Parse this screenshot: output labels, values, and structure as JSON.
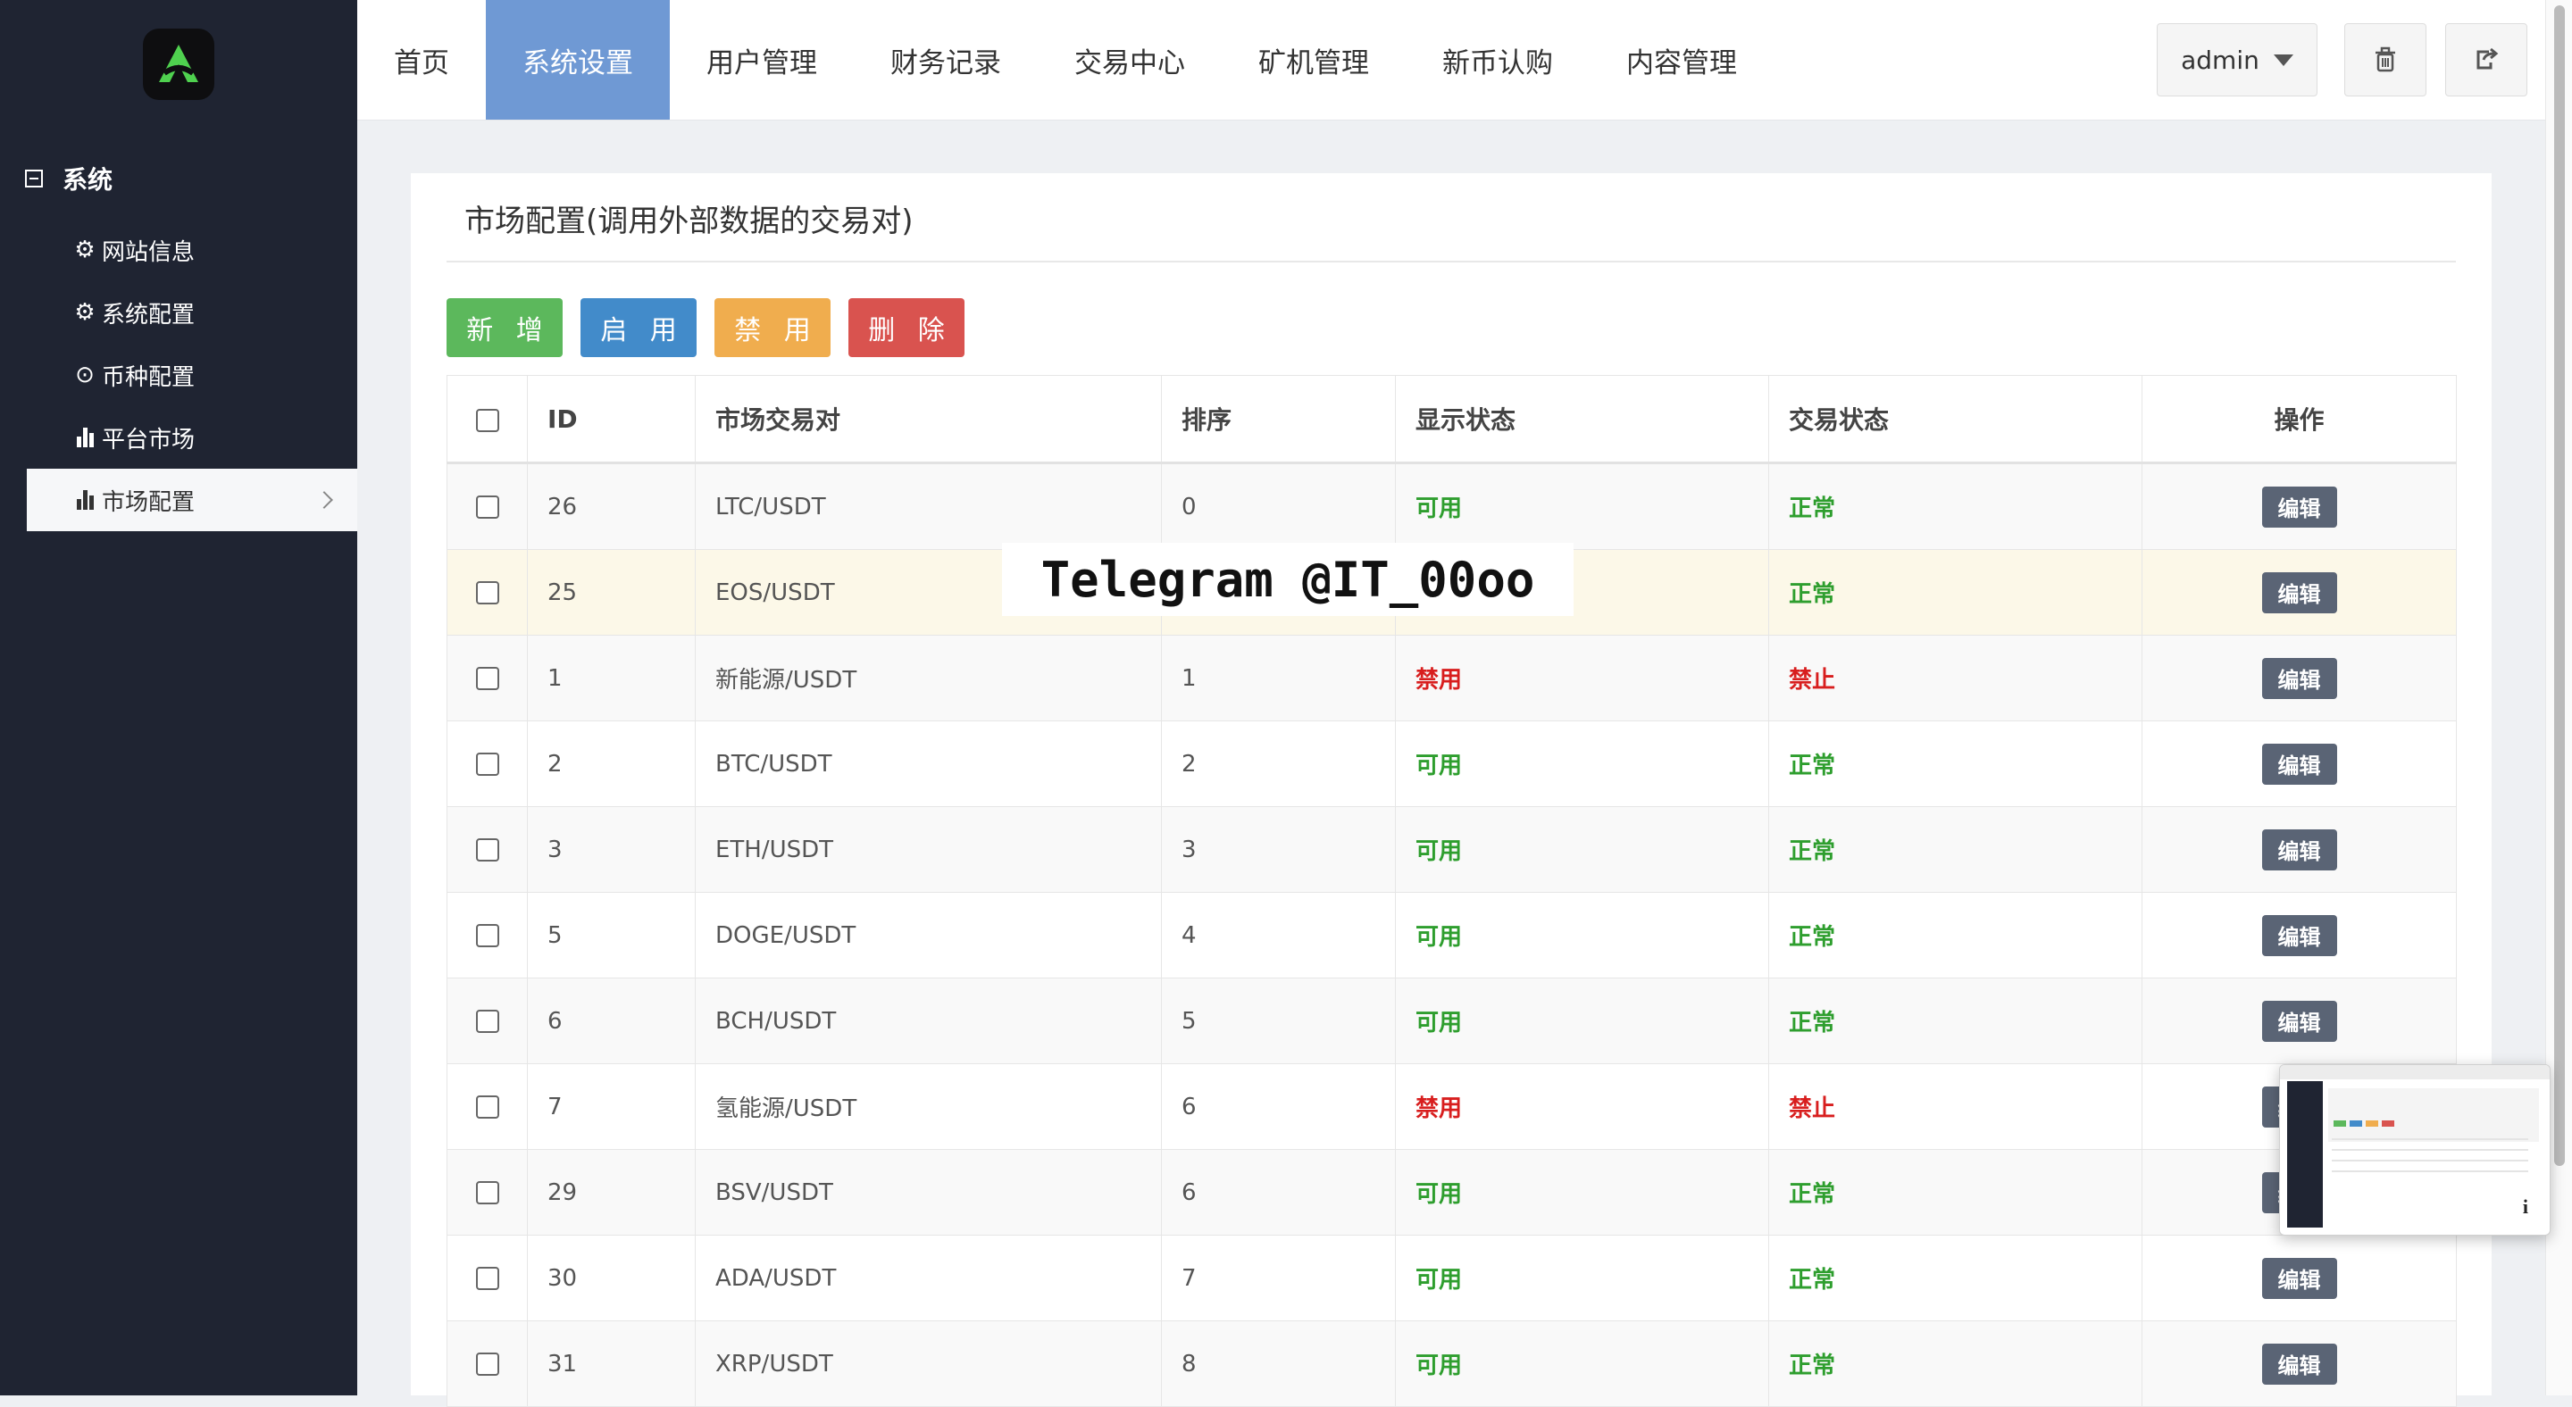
{
  "sidebar": {
    "section_title": "系统",
    "items": [
      {
        "label": "网站信息",
        "icon": "gear-icon"
      },
      {
        "label": "系统配置",
        "icon": "gear-icon"
      },
      {
        "label": "币种配置",
        "icon": "target-icon"
      },
      {
        "label": "平台市场",
        "icon": "bar-chart-icon"
      },
      {
        "label": "市场配置",
        "icon": "bar-chart-icon",
        "active": true
      }
    ]
  },
  "nav": {
    "tabs": [
      "首页",
      "系统设置",
      "用户管理",
      "财务记录",
      "交易中心",
      "矿机管理",
      "新币认购",
      "内容管理"
    ],
    "active_tab": "系统设置"
  },
  "user_menu": {
    "label": "admin"
  },
  "panel": {
    "title": "市场配置(调用外部数据的交易对)",
    "buttons": {
      "add": "新 增",
      "enable": "启 用",
      "disable": "禁 用",
      "delete": "删 除"
    }
  },
  "table": {
    "headers": {
      "id": "ID",
      "pair": "市场交易对",
      "sort": "排序",
      "display": "显示状态",
      "trade": "交易状态",
      "ops": "操作"
    },
    "edit_label": "编辑",
    "rows": [
      {
        "id": "26",
        "pair": "LTC/USDT",
        "sort": "0",
        "display": "可用",
        "trade": "正常"
      },
      {
        "id": "25",
        "pair": "EOS/USDT",
        "sort": "",
        "display": "",
        "trade": "正常"
      },
      {
        "id": "1",
        "pair": "新能源/USDT",
        "sort": "1",
        "display": "禁用",
        "trade": "禁止"
      },
      {
        "id": "2",
        "pair": "BTC/USDT",
        "sort": "2",
        "display": "可用",
        "trade": "正常"
      },
      {
        "id": "3",
        "pair": "ETH/USDT",
        "sort": "3",
        "display": "可用",
        "trade": "正常"
      },
      {
        "id": "5",
        "pair": "DOGE/USDT",
        "sort": "4",
        "display": "可用",
        "trade": "正常"
      },
      {
        "id": "6",
        "pair": "BCH/USDT",
        "sort": "5",
        "display": "可用",
        "trade": "正常"
      },
      {
        "id": "7",
        "pair": "氢能源/USDT",
        "sort": "6",
        "display": "禁用",
        "trade": "禁止"
      },
      {
        "id": "29",
        "pair": "BSV/USDT",
        "sort": "6",
        "display": "可用",
        "trade": "正常"
      },
      {
        "id": "30",
        "pair": "ADA/USDT",
        "sort": "7",
        "display": "可用",
        "trade": "正常"
      },
      {
        "id": "31",
        "pair": "XRP/USDT",
        "sort": "8",
        "display": "可用",
        "trade": "正常"
      }
    ]
  },
  "watermark": "Telegram @IT_00oo",
  "thumbnail": {
    "info_glyph": "i"
  },
  "colors": {
    "sidebar_bg": "#1f2432",
    "active_tab": "#6f99d4",
    "ok": "#2e9e2e",
    "bad": "#d81e1e"
  }
}
